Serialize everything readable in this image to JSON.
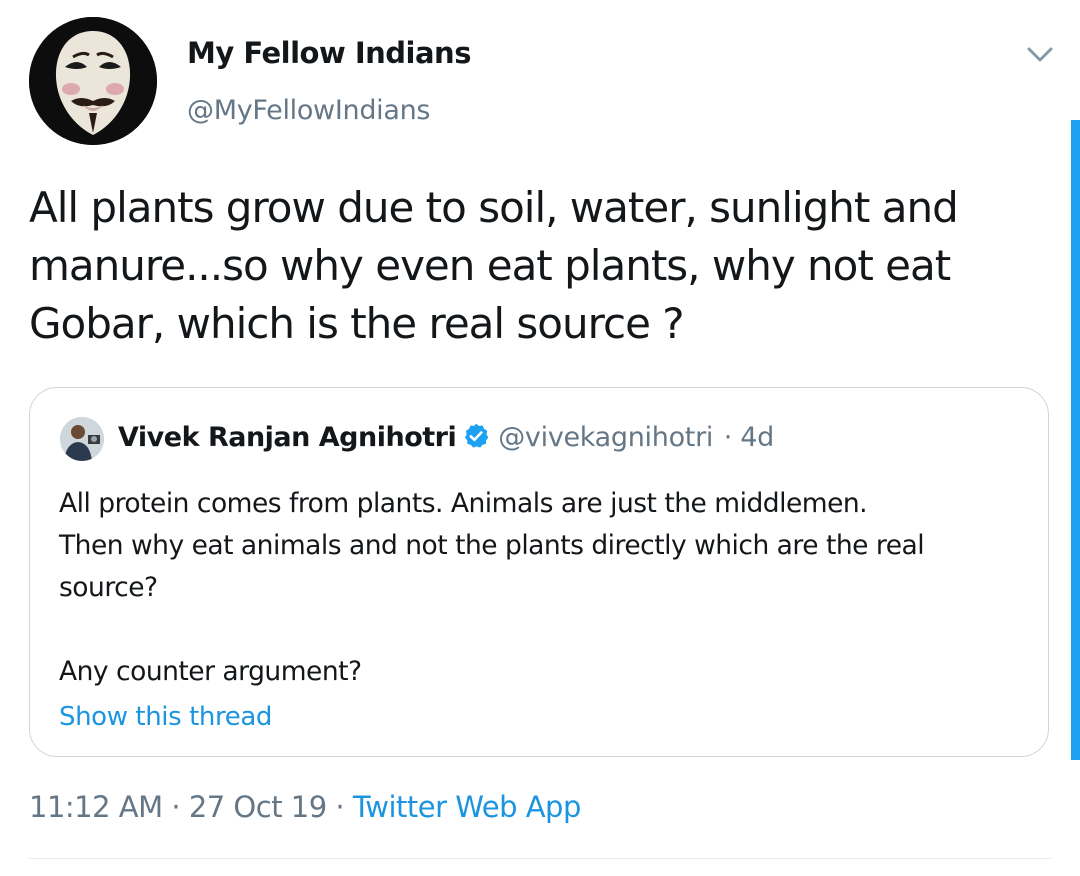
{
  "tweet": {
    "display_name": "My Fellow Indians",
    "handle": "@MyFellowIndians",
    "text_lines": [
      "All plants grow due to soil, water, sunlight and",
      "manure...so why even eat plants, why not eat",
      "Gobar, which is the real source ?"
    ],
    "time": "11:12 AM",
    "date": "27 Oct 19",
    "separator": "·",
    "source_app": "Twitter Web App"
  },
  "quoted_tweet": {
    "display_name": "Vivek Ranjan Agnihotri",
    "verified": true,
    "handle": "@vivekagnihotri",
    "age": "· 4d",
    "body_lines": [
      "All protein comes from plants. Animals are just the middlemen.",
      "Then why eat animals and not the plants directly which are the real",
      "source?"
    ],
    "body_last_line": "Any counter argument?",
    "show_thread_label": "Show this thread"
  },
  "colors": {
    "accent": "#1da1f2",
    "link": "#1b95e0",
    "secondary_text": "#657786",
    "primary_text": "#14171a",
    "border": "#ccd6dd"
  },
  "icons": {
    "caret": "chevron-down-icon",
    "verified": "verified-badge-icon"
  }
}
